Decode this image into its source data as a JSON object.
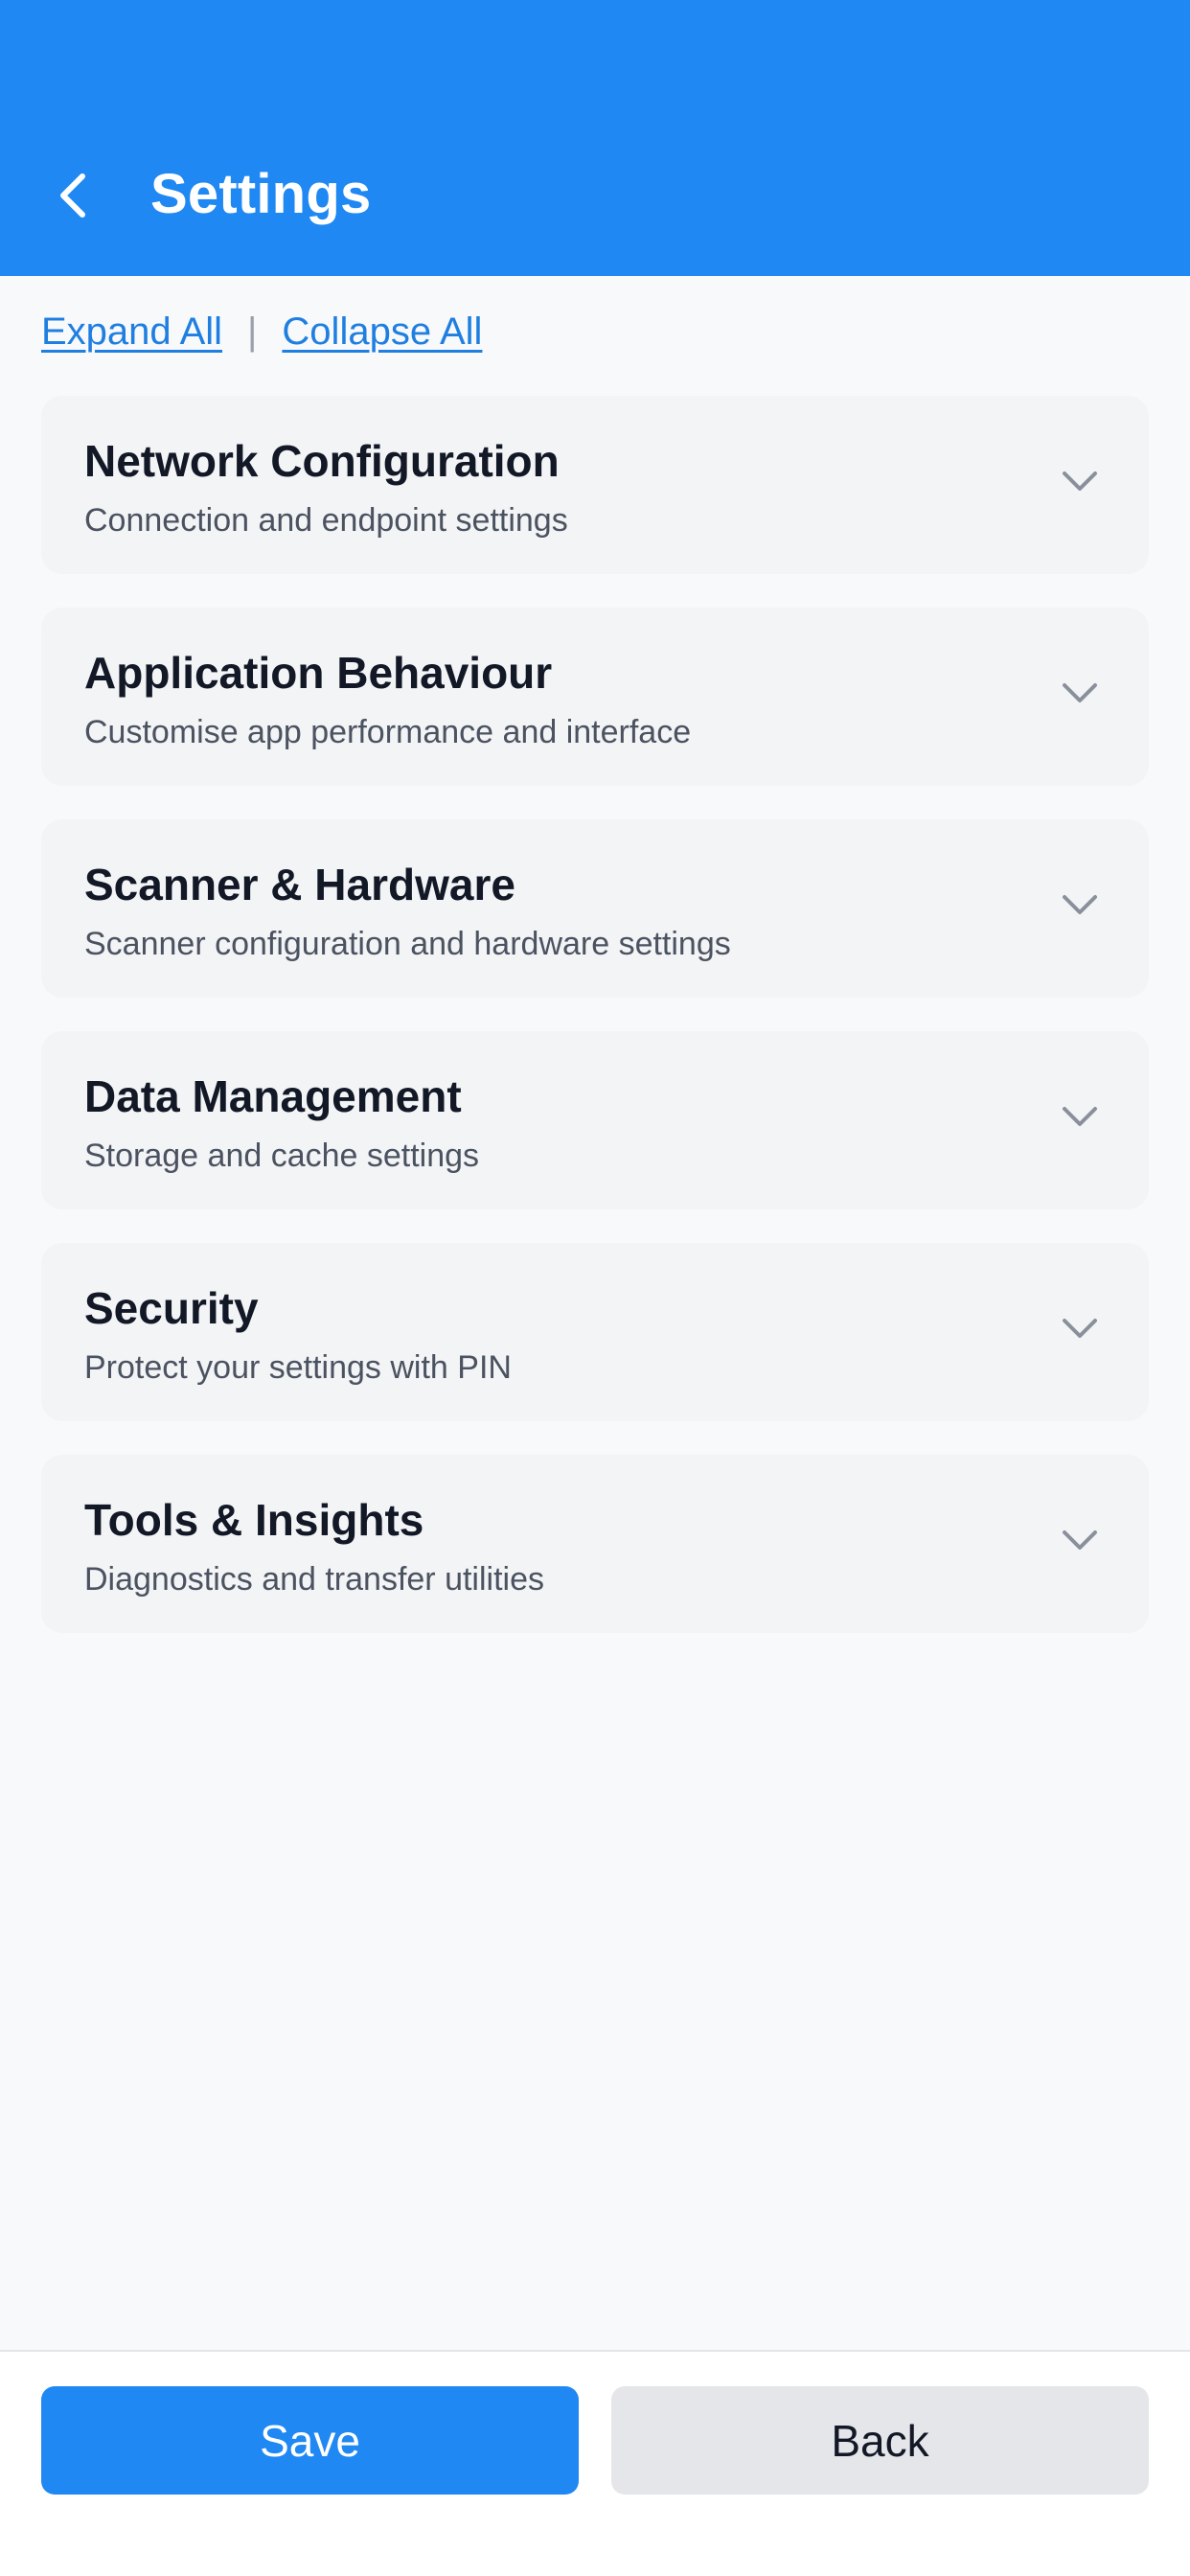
{
  "header": {
    "title": "Settings",
    "background_color": "#1f88f2",
    "back_icon": "chevron-left-icon"
  },
  "toolbar": {
    "expand_all": "Expand All",
    "separator": "|",
    "collapse_all": "Collapse All"
  },
  "sections": [
    {
      "title": "Network Configuration",
      "subtitle": "Connection and endpoint settings",
      "expanded": false
    },
    {
      "title": "Application Behaviour",
      "subtitle": "Customise app performance and interface",
      "expanded": false
    },
    {
      "title": "Scanner & Hardware",
      "subtitle": "Scanner configuration and hardware settings",
      "expanded": false
    },
    {
      "title": "Data Management",
      "subtitle": "Storage and cache settings",
      "expanded": false
    },
    {
      "title": "Security",
      "subtitle": "Protect your settings with PIN",
      "expanded": false
    },
    {
      "title": "Tools & Insights",
      "subtitle": "Diagnostics and transfer utilities",
      "expanded": false
    }
  ],
  "footer": {
    "save_label": "Save",
    "back_label": "Back"
  },
  "colors": {
    "accent": "#1f88f2",
    "link": "#1f7fe0",
    "card_background": "#f3f4f6",
    "secondary_button": "#e5e6e9"
  }
}
